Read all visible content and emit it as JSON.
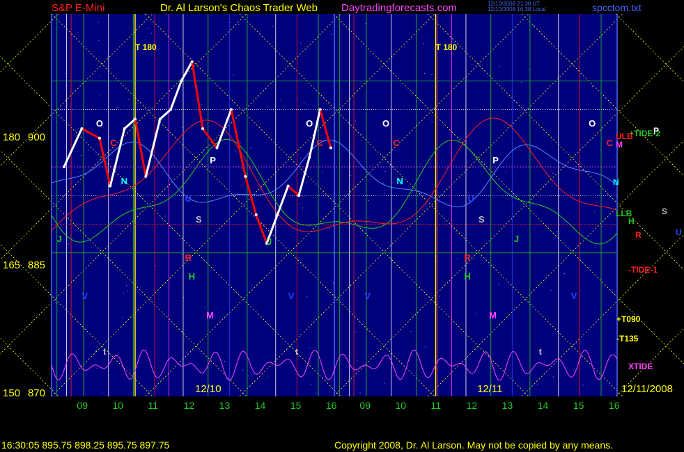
{
  "header": {
    "symbol": "S&P E-Mini",
    "title": "Dr. Al Larson's Chaos Trader Web",
    "site": "Daytradingforecasts.com",
    "stamp_line1": "12/10/2008 21:38 UT",
    "stamp_line2": "12/10/2008 16:38 Local",
    "filename": "spcctom.txt"
  },
  "footer": {
    "quote": "16:30:05  895.75  898.25  895.75  897.75",
    "copyright": "Copyright 2008, Dr. Al Larson. May not be copied by any means."
  },
  "colors": {
    "background": "#00007a",
    "price_up": "#ffffff",
    "price_down": "#ff0000",
    "tide_green": "#22cc22",
    "tide_red": "#ff2020",
    "grid_yellow": "#ffff00",
    "magenta": "#ff44ff"
  },
  "left_axis": {
    "outer_labels": [
      "180",
      "165",
      "150"
    ],
    "price_labels": [
      "900",
      "885",
      "870"
    ]
  },
  "date_labels": [
    "12/10",
    "12/11",
    "12/11/2008"
  ],
  "chart_data": {
    "type": "line",
    "title": "S&P E-Mini",
    "xlabel": "",
    "ylabel": "",
    "ylim": [
      870,
      910
    ],
    "x_tick_labels": [
      "09",
      "10",
      "11",
      "12",
      "13",
      "14",
      "15",
      "16",
      "09",
      "10",
      "11",
      "12",
      "13",
      "14",
      "15",
      "16"
    ],
    "y_tick_labels": [
      "900",
      "885",
      "870"
    ],
    "grid": true,
    "price_series": [
      {
        "hour": 8.5,
        "price": 894
      },
      {
        "hour": 9.0,
        "price": 898
      },
      {
        "hour": 9.5,
        "price": 897
      },
      {
        "hour": 9.8,
        "price": 892
      },
      {
        "hour": 10.2,
        "price": 898
      },
      {
        "hour": 10.5,
        "price": 899
      },
      {
        "hour": 10.8,
        "price": 893
      },
      {
        "hour": 11.2,
        "price": 899
      },
      {
        "hour": 11.5,
        "price": 900
      },
      {
        "hour": 11.8,
        "price": 903
      },
      {
        "hour": 12.1,
        "price": 905
      },
      {
        "hour": 12.4,
        "price": 898
      },
      {
        "hour": 12.8,
        "price": 896
      },
      {
        "hour": 13.2,
        "price": 900
      },
      {
        "hour": 13.6,
        "price": 893
      },
      {
        "hour": 13.9,
        "price": 889
      },
      {
        "hour": 14.2,
        "price": 886
      },
      {
        "hour": 14.5,
        "price": 889
      },
      {
        "hour": 14.8,
        "price": 892
      },
      {
        "hour": 15.1,
        "price": 891
      },
      {
        "hour": 15.4,
        "price": 895
      },
      {
        "hour": 15.7,
        "price": 900
      },
      {
        "hour": 16.0,
        "price": 896
      }
    ],
    "right_labels": [
      {
        "text": "+TIDE-2",
        "color": "#22cc22"
      },
      {
        "text": "ULB",
        "color": "#ff2020"
      },
      {
        "text": "P",
        "color": "#ffffff"
      },
      {
        "text": "M",
        "color": "#ff44ff"
      },
      {
        "text": "N",
        "color": "#00ffff"
      },
      {
        "text": "LLB",
        "color": "#22cc22"
      },
      {
        "text": "S",
        "color": "#bbbbbb"
      },
      {
        "text": "H",
        "color": "#22cc22"
      },
      {
        "text": "R",
        "color": "#ff2020"
      },
      {
        "text": "U",
        "color": "#2244ff"
      },
      {
        "text": "-TIDE-1",
        "color": "#ff2020"
      },
      {
        "text": "+T090",
        "color": "#ffff00"
      },
      {
        "text": "-T135",
        "color": "#ffff00"
      },
      {
        "text": "XTIDE",
        "color": "#ff44ff"
      }
    ],
    "annotations": [
      {
        "text": "T 180",
        "color": "#ffff00"
      },
      {
        "text": "T 180",
        "color": "#ffff00"
      },
      {
        "text": "O",
        "color": "#ffffff"
      },
      {
        "text": "O",
        "color": "#ffffff"
      },
      {
        "text": "O",
        "color": "#ffffff"
      },
      {
        "text": "O",
        "color": "#ffffff"
      },
      {
        "text": "C",
        "color": "#ff2020"
      },
      {
        "text": "C",
        "color": "#ff2020"
      },
      {
        "text": "C",
        "color": "#ff2020"
      },
      {
        "text": "C",
        "color": "#ff2020"
      },
      {
        "text": "N",
        "color": "#00ffff"
      },
      {
        "text": "N",
        "color": "#00ffff"
      },
      {
        "text": "P",
        "color": "#ffffff"
      },
      {
        "text": "P",
        "color": "#ffffff"
      },
      {
        "text": "S",
        "color": "#bbbbbb"
      },
      {
        "text": "S",
        "color": "#bbbbbb"
      },
      {
        "text": "U",
        "color": "#2244ff"
      },
      {
        "text": "U",
        "color": "#2244ff"
      },
      {
        "text": "R",
        "color": "#ff2020"
      },
      {
        "text": "R",
        "color": "#ff2020"
      },
      {
        "text": "H",
        "color": "#22cc22"
      },
      {
        "text": "H",
        "color": "#22cc22"
      },
      {
        "text": "J",
        "color": "#22cc22"
      },
      {
        "text": "J",
        "color": "#22cc22"
      },
      {
        "text": "J",
        "color": "#22cc22"
      },
      {
        "text": "V",
        "color": "#2244ff"
      },
      {
        "text": "V",
        "color": "#2244ff"
      },
      {
        "text": "V",
        "color": "#2244ff"
      },
      {
        "text": "V",
        "color": "#2244ff"
      },
      {
        "text": "M",
        "color": "#ff44ff"
      },
      {
        "text": "M",
        "color": "#ff44ff"
      },
      {
        "text": "t",
        "color": "#bbbbbb"
      },
      {
        "text": "t",
        "color": "#bbbbbb"
      },
      {
        "text": "t",
        "color": "#bbbbbb"
      }
    ]
  }
}
